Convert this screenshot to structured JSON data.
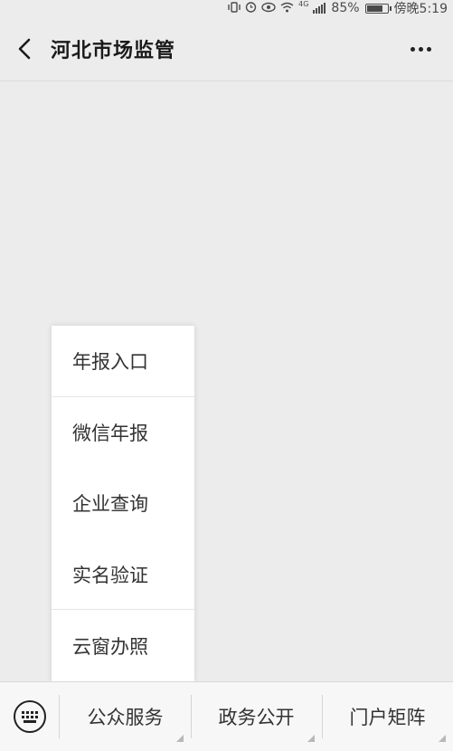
{
  "status_bar": {
    "battery_percent": "85%",
    "battery_level": 0.85,
    "network_label": "4G",
    "time": "傍晚5:19",
    "icons": [
      "vibrate-icon",
      "alarm-icon",
      "eye-icon",
      "wifi-icon",
      "signal-icon",
      "battery-icon"
    ]
  },
  "nav": {
    "title": "河北市场监管",
    "back_icon": "chevron-left-icon",
    "more_icon": "more-dots-icon"
  },
  "popup_menu": {
    "items": [
      {
        "label": "年报入口"
      },
      {
        "label": "微信年报"
      },
      {
        "label": "企业查询"
      },
      {
        "label": "实名验证"
      },
      {
        "label": "云窗办照"
      }
    ]
  },
  "bottom_bar": {
    "keyboard_icon": "keyboard-icon",
    "tabs": [
      {
        "label": "公众服务"
      },
      {
        "label": "政务公开"
      },
      {
        "label": "门户矩阵"
      }
    ]
  },
  "colors": {
    "background": "#ececec",
    "menu_background": "#ffffff",
    "bottom_bar_background": "#f7f7f7",
    "text": "#1a1a1a"
  }
}
